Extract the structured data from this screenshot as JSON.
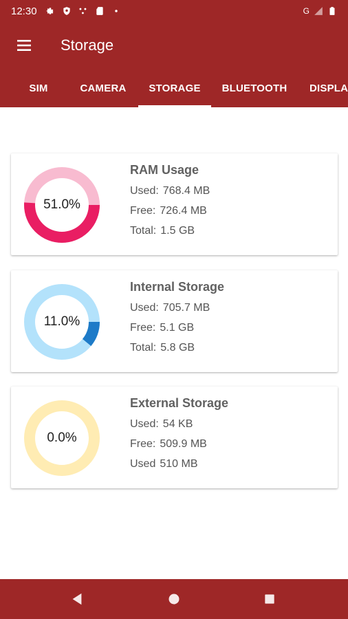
{
  "status_bar": {
    "time": "12:30",
    "network": "G",
    "icons": [
      "gear-icon",
      "shield-icon",
      "network-dots-icon",
      "sd-card-icon",
      "dot-icon"
    ]
  },
  "app_bar": {
    "title": "Storage",
    "menu_icon": "hamburger-menu-icon"
  },
  "tabs": [
    {
      "label": "SIM",
      "active": false
    },
    {
      "label": "CAMERA",
      "active": false
    },
    {
      "label": "STORAGE",
      "active": true
    },
    {
      "label": "BLUETOOTH",
      "active": false
    },
    {
      "label": "DISPLA",
      "active": false
    }
  ],
  "cards": [
    {
      "title": "RAM Usage",
      "percent_label": "51.0%",
      "percent": 51.0,
      "color_used": "#e91e63",
      "color_free": "#f8bbd0",
      "rows": [
        {
          "label": "Used:",
          "value": "768.4 MB"
        },
        {
          "label": "Free:",
          "value": "726.4 MB"
        },
        {
          "label": "Total:",
          "value": "1.5 GB"
        }
      ]
    },
    {
      "title": "Internal Storage",
      "percent_label": "11.0%",
      "percent": 11.0,
      "color_used": "#1e7bc8",
      "color_free": "#b3e2fb",
      "rows": [
        {
          "label": "Used:",
          "value": "705.7 MB"
        },
        {
          "label": "Free:",
          "value": "5.1 GB"
        },
        {
          "label": "Total:",
          "value": "5.8 GB"
        }
      ]
    },
    {
      "title": "External Storage",
      "percent_label": "0.0%",
      "percent": 0.0,
      "color_used": "#ffc107",
      "color_free": "#ffecb3",
      "rows": [
        {
          "label": "Used:",
          "value": "54 KB"
        },
        {
          "label": "Free:",
          "value": "509.9 MB"
        },
        {
          "label": "Used",
          "value": "510 MB"
        }
      ]
    }
  ],
  "nav_bar": {
    "icons": [
      "back-icon",
      "home-icon",
      "recents-icon"
    ]
  },
  "colors": {
    "primary": "#9e2727",
    "text_title": "#616161",
    "text_body": "#555555"
  }
}
